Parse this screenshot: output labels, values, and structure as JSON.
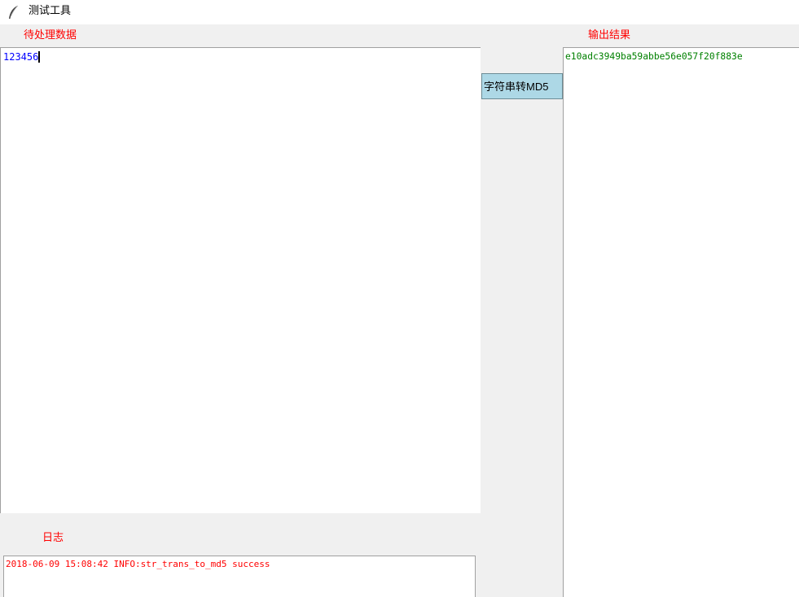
{
  "window": {
    "title": "测试工具",
    "icon": "feather-icon"
  },
  "input": {
    "label": "待处理数据",
    "value": "123456",
    "text_color": "#0000ff"
  },
  "convert_button": {
    "label": "字符串转MD5",
    "background": "#add8e6"
  },
  "output": {
    "label": "输出结果",
    "value": "e10adc3949ba59abbe56e057f20f883e",
    "text_color": "#008000"
  },
  "log": {
    "label": "日志",
    "lines": [
      "2018-06-09 15:08:42 INFO:str_trans_to_md5 success"
    ],
    "text_color": "#ff0000"
  },
  "colors": {
    "label_color": "#ff0000",
    "window_background": "#f0f0f0"
  }
}
